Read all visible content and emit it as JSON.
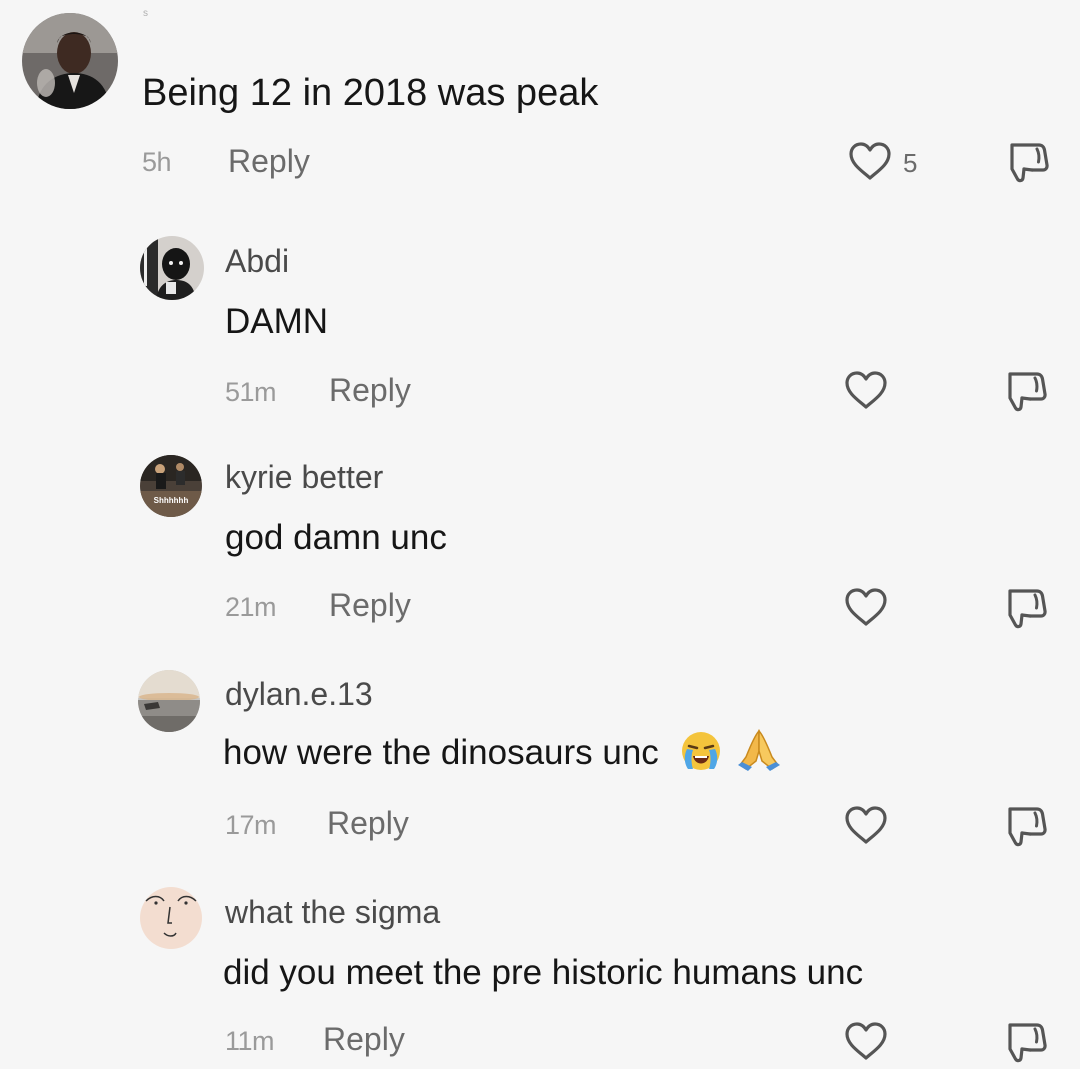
{
  "colors": {
    "background": "#f6f6f6",
    "text": "#161616",
    "username": "#4a4a4a",
    "meta": "#9a9a9a",
    "reply": "#6b6b6b",
    "icon_stroke": "#555555"
  },
  "top_mark": "s",
  "main_comment": {
    "text": "Being 12 in 2018 was peak",
    "time": "5h",
    "reply_label": "Reply",
    "likes": "5",
    "avatar_icon": "user-avatar-photo"
  },
  "replies": [
    {
      "username": "Abdi",
      "text": "DAMN",
      "time": "51m",
      "reply_label": "Reply",
      "avatar_icon": "user-avatar-photo"
    },
    {
      "username": "kyrie better",
      "text": "god damn unc",
      "time": "21m",
      "reply_label": "Reply",
      "avatar_icon": "user-avatar-photo",
      "avatar_caption": "Shhhhhh"
    },
    {
      "username": "dylan.e.13",
      "text": "how were the dinosaurs unc",
      "time": "17m",
      "reply_label": "Reply",
      "avatar_icon": "user-avatar-photo",
      "emojis": [
        "loudly-crying-face-emoji",
        "folded-hands-emoji"
      ]
    },
    {
      "username": "what the sigma",
      "text": "did you meet the pre historic humans unc",
      "time": "11m",
      "reply_label": "Reply",
      "avatar_icon": "user-avatar-drawing"
    }
  ],
  "icons": {
    "like": "heart-outline-icon",
    "dislike": "thumbs-down-outline-icon"
  }
}
